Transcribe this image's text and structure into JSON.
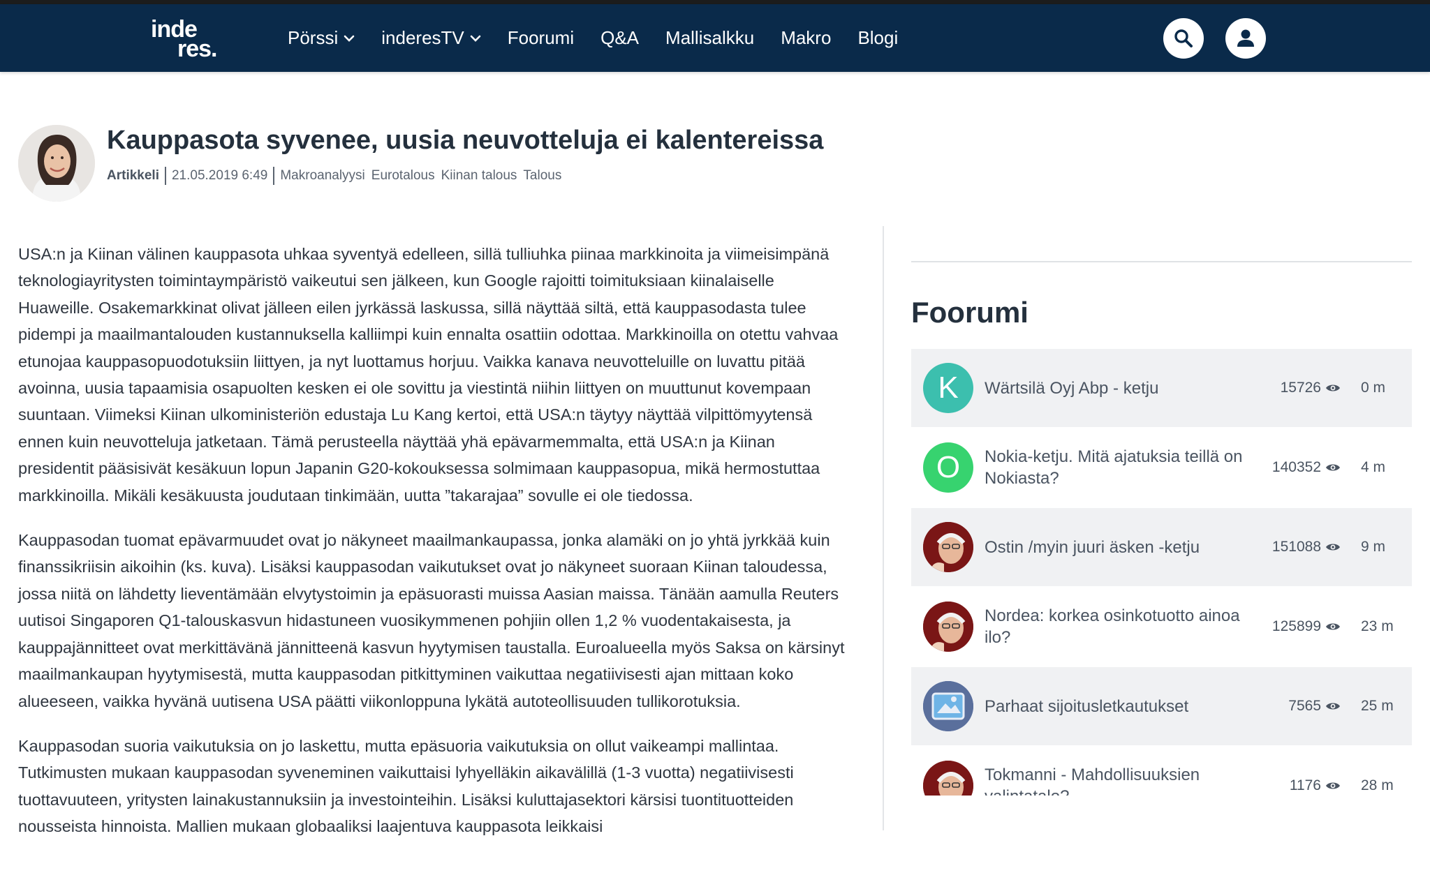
{
  "nav": {
    "logo_line1": "inde",
    "logo_line2": "res.",
    "links": [
      {
        "label": "Pörssi",
        "dropdown": true
      },
      {
        "label": "inderesTV",
        "dropdown": true
      },
      {
        "label": "Foorumi",
        "dropdown": false
      },
      {
        "label": "Q&A",
        "dropdown": false
      },
      {
        "label": "Mallisalkku",
        "dropdown": false
      },
      {
        "label": "Makro",
        "dropdown": false
      },
      {
        "label": "Blogi",
        "dropdown": false
      }
    ],
    "search_icon": "search-icon",
    "user_icon": "user-icon",
    "bar_color": "#0a2a4a"
  },
  "article": {
    "title": "Kauppasota syvenee, uusia neuvotteluja ei kalentereissa",
    "type": "Artikkeli",
    "date": "21.05.2019 6:49",
    "tags": [
      "Makroanalyysi",
      "Eurotalous",
      "Kiinan talous",
      "Talous"
    ],
    "paragraphs": [
      "USA:n ja Kiinan välinen kauppasota uhkaa syventyä edelleen, sillä tulliuhka piinaa markkinoita ja viimeisimpänä teknologiayritysten toimintaympäristö vaikeutui sen jälkeen, kun Google rajoitti toimituksiaan kiinalaiselle Huaweille. Osakemarkkinat olivat jälleen eilen jyrkässä laskussa, sillä näyttää siltä, että kauppasodasta tulee pidempi ja maailmantalouden kustannuksella kalliimpi kuin ennalta osattiin odottaa. Markkinoilla on otettu vahvaa etunojaa kauppasopuodotuksiin liittyen, ja nyt luottamus horjuu. Vaikka kanava neuvotteluille on luvattu pitää avoinna, uusia tapaamisia osapuolten kesken ei ole sovittu ja viestintä niihin liittyen on muuttunut kovempaan suuntaan. Viimeksi Kiinan ulkoministeriön edustaja Lu Kang kertoi, että USA:n täytyy näyttää vilpittömyytensä ennen kuin neuvotteluja jatketaan. Tämä perusteella näyttää yhä epävarmemmalta, että USA:n ja Kiinan presidentit pääsisivät kesäkuun lopun Japanin G20-kokouksessa solmimaan kauppasopua, mikä hermostuttaa markkinoilla. Mikäli kesäkuusta joudutaan tinkimään, uutta ”takarajaa” sovulle ei ole tiedossa.",
      "Kauppasodan tuomat epävarmuudet ovat jo näkyneet maailmankaupassa, jonka alamäki on jo yhtä jyrkkää kuin finanssikriisin aikoihin (ks. kuva). Lisäksi kauppasodan vaikutukset ovat jo näkyneet suoraan Kiinan taloudessa, jossa niitä on lähdetty lieventämään elvytystoimin ja epäsuorasti muissa Aasian maissa. Tänään aamulla Reuters uutisoi Singaporen Q1-talouskasvun hidastuneen vuosikymmenen pohjiin ollen 1,2 % vuodentakaisesta, ja kauppajännitteet ovat merkittävänä jännitteenä kasvun hyytymisen taustalla. Euroalueella myös Saksa on kärsinyt maailmankaupan hyytymisestä, mutta kauppasodan pitkittyminen vaikuttaa negatiivisesti ajan mittaan koko alueeseen, vaikka hyvänä uutisena USA päätti viikonloppuna lykätä autoteollisuuden tullikorotuksia.",
      "Kauppasodan suoria vaikutuksia on jo laskettu, mutta epäsuoria vaikutuksia on ollut vaikeampi mallintaa. Tutkimusten mukaan kauppasodan syveneminen vaikuttaisi lyhyelläkin aikavälillä (1-3 vuotta) negatiivisesti tuottavuuteen, yritysten lainakustannuksiin ja investointeihin. Lisäksi kuluttajasektori kärsisi tuontituotteiden nousseista hinnoista. Mallien mukaan globaaliksi laajentuva kauppasota leikkaisi"
    ]
  },
  "sidebar": {
    "title": "Foorumi",
    "threads": [
      {
        "avatar_letter": "K",
        "avatar_color": "#3cbfae",
        "avatar_kind": "letter",
        "title": "Wärtsilä Oyj Abp - ketju",
        "views": "15726",
        "time": "0 m"
      },
      {
        "avatar_letter": "O",
        "avatar_color": "#37d36f",
        "avatar_kind": "letter",
        "title": "Nokia-ketju. Mitä ajatuksia teillä on Nokiasta?",
        "views": "140352",
        "time": "4 m"
      },
      {
        "avatar_letter": "",
        "avatar_color": "#8a1c1c",
        "avatar_kind": "portrait",
        "title": "Ostin /myin juuri äsken -ketju",
        "views": "151088",
        "time": "9 m"
      },
      {
        "avatar_letter": "",
        "avatar_color": "#8a1c1c",
        "avatar_kind": "portrait",
        "title": "Nordea: korkea osinkotuotto ainoa ilo?",
        "views": "125899",
        "time": "23 m"
      },
      {
        "avatar_letter": "",
        "avatar_color": "#3f5fa8",
        "avatar_kind": "picture",
        "title": "Parhaat sijoitusletkautukset",
        "views": "7565",
        "time": "25 m"
      },
      {
        "avatar_letter": "",
        "avatar_color": "#8a1c1c",
        "avatar_kind": "portrait",
        "title": "Tokmanni - Mahdollisuuksien valintatalo?",
        "views": "1176",
        "time": "28 m"
      }
    ],
    "views_icon": "eye-icon"
  }
}
